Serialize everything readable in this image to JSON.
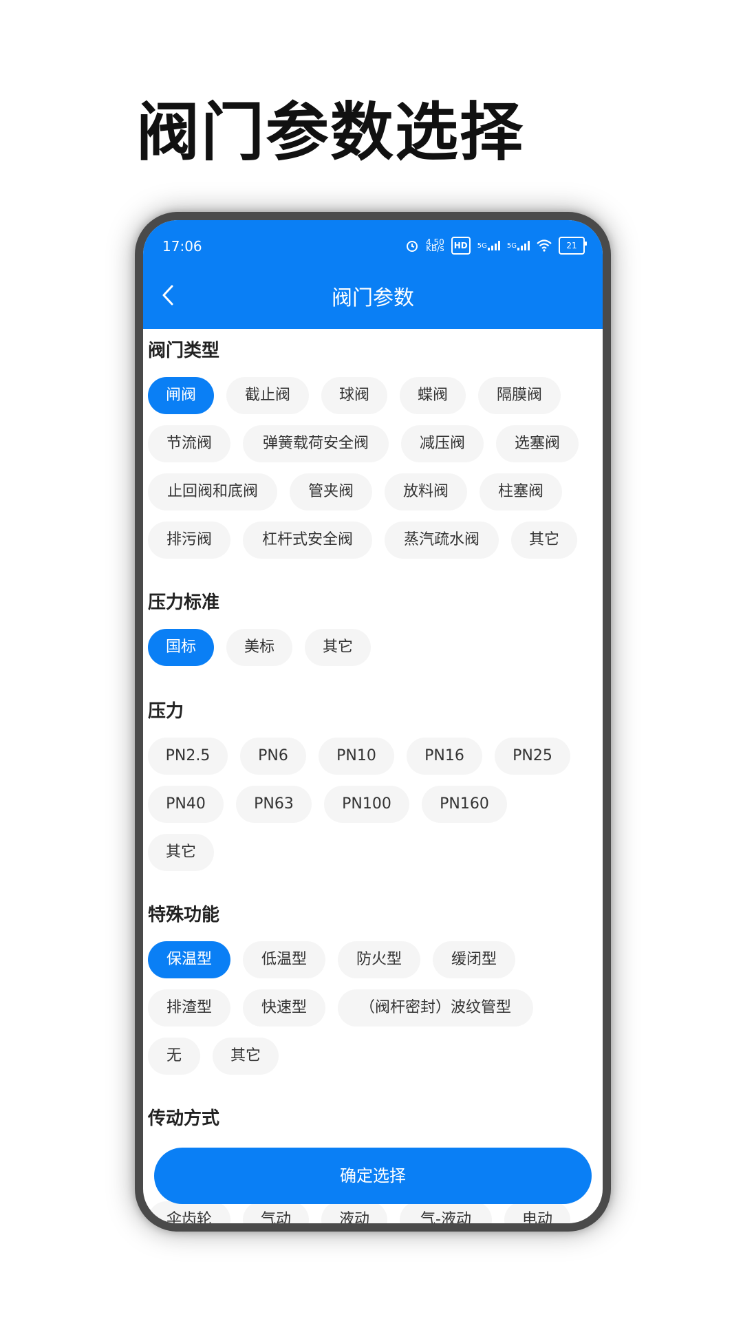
{
  "promo": {
    "title": "阀门参数选择"
  },
  "status_bar": {
    "time": "17:06",
    "net_speed_value": "4.50",
    "net_speed_unit": "KB/s",
    "hd_label": "HD",
    "sim1_label": "5G",
    "sim2_label": "5G",
    "battery_level": "21"
  },
  "nav": {
    "title": "阀门参数"
  },
  "sections": [
    {
      "title": "阀门类型",
      "options": [
        "闸阀",
        "截止阀",
        "球阀",
        "蝶阀",
        "隔膜阀",
        "节流阀",
        "弹簧载荷安全阀",
        "减压阀",
        "选塞阀",
        "止回阀和底阀",
        "管夹阀",
        "放料阀",
        "柱塞阀",
        "排污阀",
        "杠杆式安全阀",
        "蒸汽疏水阀",
        "其它"
      ],
      "selected": "闸阀"
    },
    {
      "title": "压力标准",
      "options": [
        "国标",
        "美标",
        "其它"
      ],
      "selected": "国标"
    },
    {
      "title": "压力",
      "options": [
        "PN2.5",
        "PN6",
        "PN10",
        "PN16",
        "PN25",
        "PN40",
        "PN63",
        "PN100",
        "PN160",
        "其它"
      ],
      "selected": ""
    },
    {
      "title": "特殊功能",
      "options": [
        "保温型",
        "低温型",
        "防火型",
        "缓闭型",
        "排渣型",
        "快速型",
        "（阀杆密封）波纹管型",
        "无",
        "其它"
      ],
      "selected": "保温型"
    },
    {
      "title": "传动方式",
      "options": [
        "伞齿轮",
        "气动",
        "液动",
        "气-液动",
        "电动"
      ],
      "selected": ""
    }
  ],
  "confirm_button": {
    "label": "确定选择"
  },
  "colors": {
    "accent": "#0a7ff5",
    "chip_bg": "#f5f5f5",
    "frame": "#4a4a4a"
  }
}
